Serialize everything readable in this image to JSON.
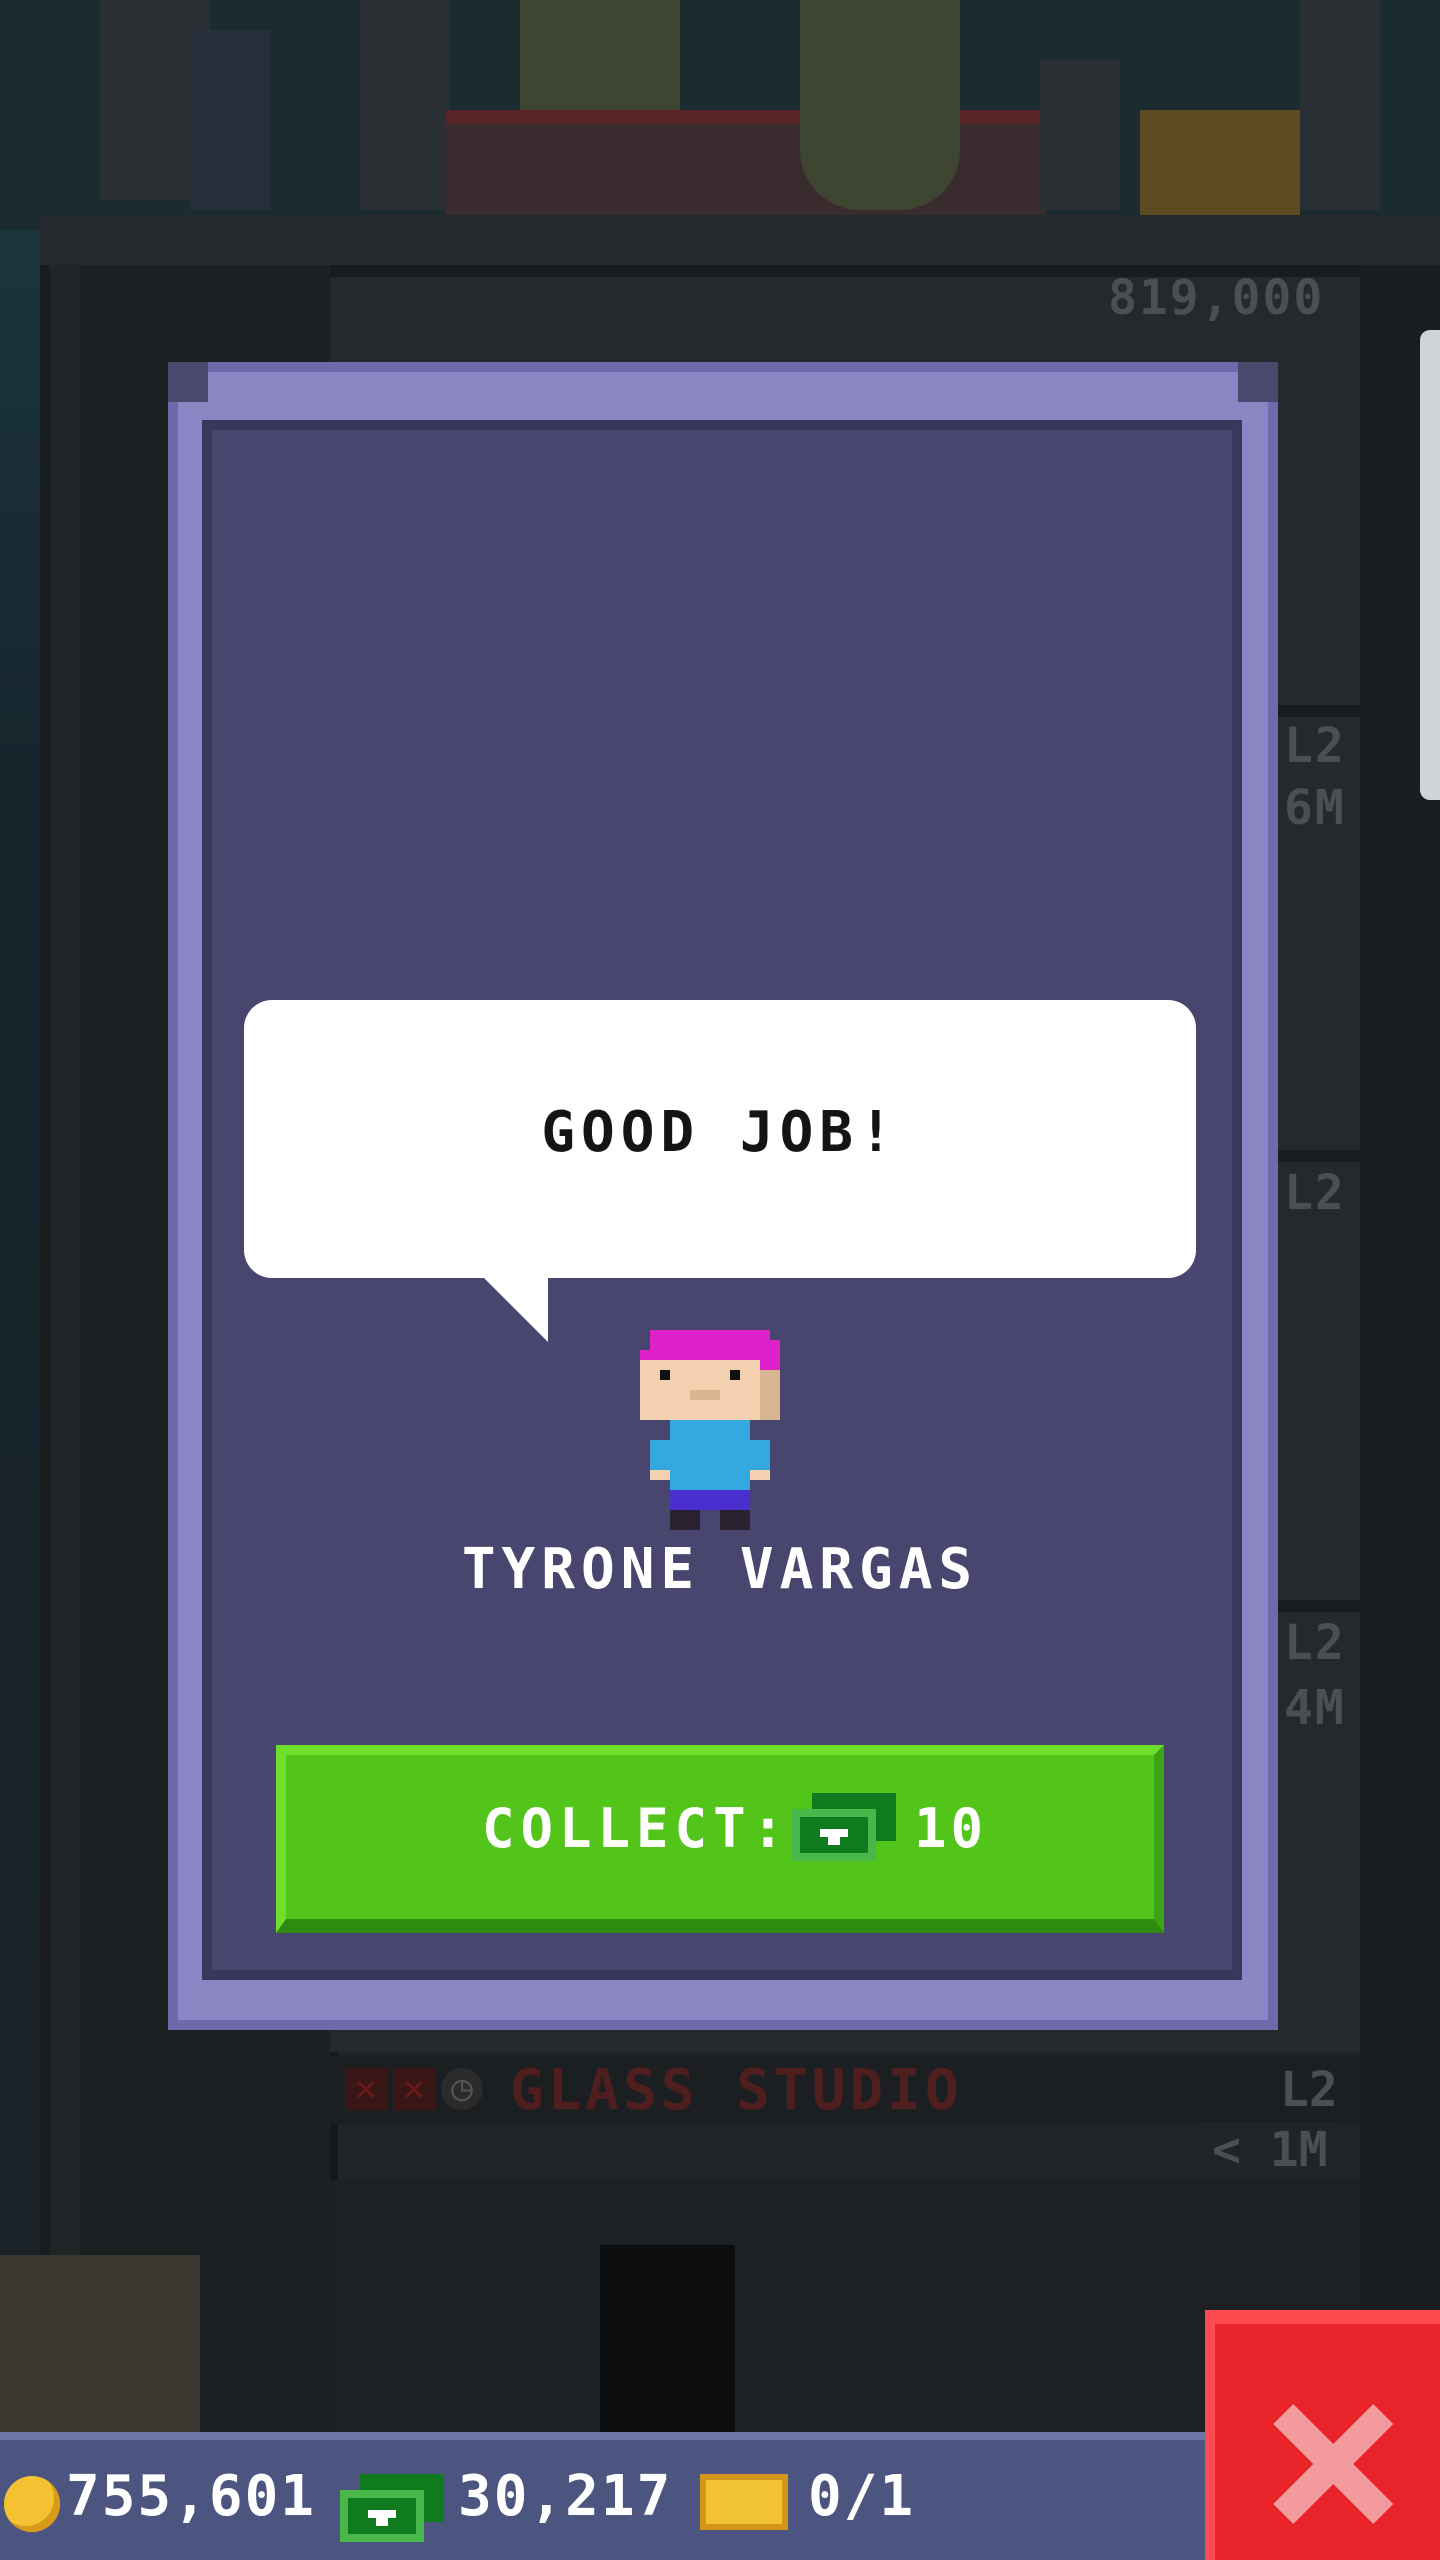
{
  "background": {
    "floor_labels": [
      "819,000",
      "L2",
      "6M",
      "L2",
      "L2",
      "4M"
    ],
    "floor": {
      "name": "GLASS STUDIO",
      "level": "L2",
      "time": "< 1M"
    }
  },
  "modal": {
    "speech": "GOOD JOB!",
    "character_name": "TYRONE VARGAS",
    "collect_label": "COLLECT:",
    "collect_amount": "10"
  },
  "hud": {
    "coins": "755,601",
    "bux": "30,217",
    "tickets": "0/1"
  },
  "icons": {
    "coin": "coin-icon",
    "bux": "bux-icon",
    "ticket": "golden-ticket-icon",
    "close": "close-icon"
  },
  "colors": {
    "modal_frame": "#8c85c4",
    "modal_body": "#48456f",
    "collect_button": "#52c41a",
    "close_button": "#e8232a",
    "hud_bar": "#4b5580",
    "character_hair": "#e020c8",
    "character_shirt": "#35a8e0"
  }
}
